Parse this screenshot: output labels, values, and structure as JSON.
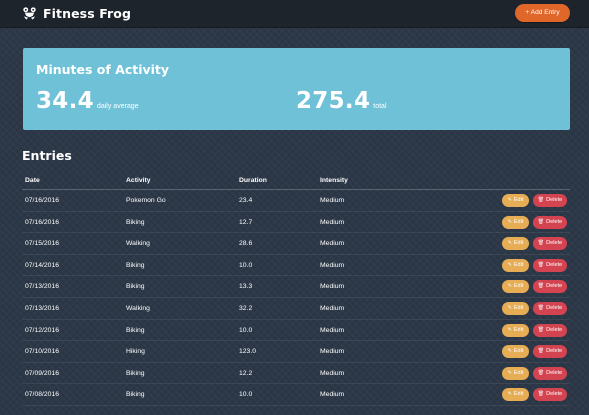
{
  "app": {
    "brand": "Fitness Frog",
    "add_entry_label": "+ Add Entry"
  },
  "stats": {
    "title": "Minutes of Activity",
    "average_value": "34.4",
    "average_label": "daily average",
    "total_value": "275.4",
    "total_label": "total"
  },
  "entries": {
    "heading": "Entries",
    "columns": {
      "date": "Date",
      "activity": "Activity",
      "duration": "Duration",
      "intensity": "Intensity"
    },
    "edit_label": "Edit",
    "delete_label": "Delete",
    "edit_icon": "pencil-icon",
    "delete_icon": "trash-icon",
    "rows": [
      {
        "date": "07/16/2016",
        "activity": "Pokemon Go",
        "duration": "23.4",
        "intensity": "Medium"
      },
      {
        "date": "07/16/2016",
        "activity": "Biking",
        "duration": "12.7",
        "intensity": "Medium"
      },
      {
        "date": "07/15/2016",
        "activity": "Walking",
        "duration": "28.6",
        "intensity": "Medium"
      },
      {
        "date": "07/14/2016",
        "activity": "Biking",
        "duration": "10.0",
        "intensity": "Medium"
      },
      {
        "date": "07/13/2016",
        "activity": "Biking",
        "duration": "13.3",
        "intensity": "Medium"
      },
      {
        "date": "07/13/2016",
        "activity": "Walking",
        "duration": "32.2",
        "intensity": "Medium"
      },
      {
        "date": "07/12/2016",
        "activity": "Biking",
        "duration": "10.0",
        "intensity": "Medium"
      },
      {
        "date": "07/10/2016",
        "activity": "Hiking",
        "duration": "123.0",
        "intensity": "Medium"
      },
      {
        "date": "07/09/2016",
        "activity": "Biking",
        "duration": "12.2",
        "intensity": "Medium"
      },
      {
        "date": "07/08/2016",
        "activity": "Biking",
        "duration": "10.0",
        "intensity": "Medium"
      }
    ]
  },
  "colors": {
    "background": "#2c3848",
    "navbar": "#1d242c",
    "accent_orange": "#e0672a",
    "stats_panel": "#6fc1d8",
    "edit_button": "#e6ad55",
    "delete_button": "#d34450"
  }
}
